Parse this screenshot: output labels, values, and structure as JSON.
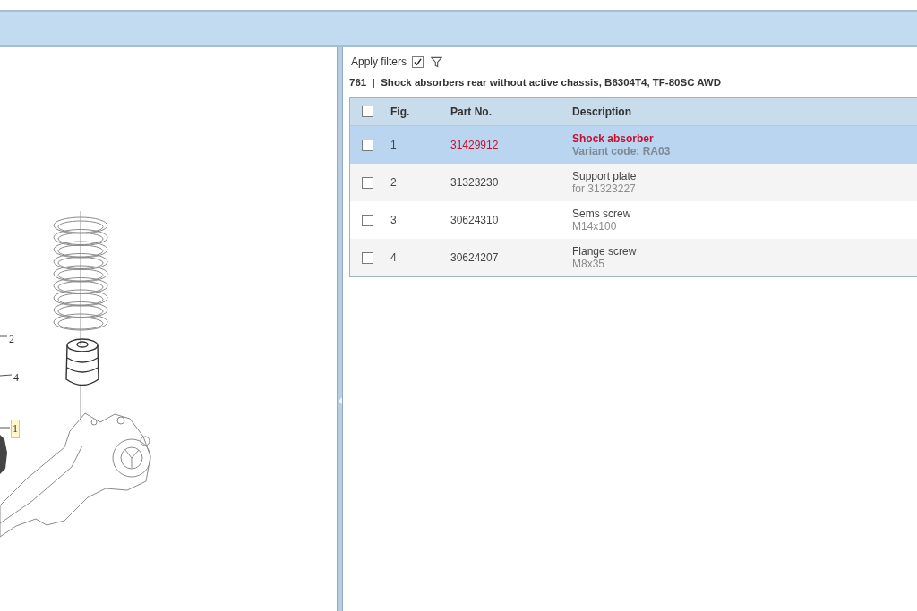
{
  "diagram": {
    "callouts": [
      {
        "label": "2",
        "selected": false
      },
      {
        "label": "4",
        "selected": false
      },
      {
        "label": "1",
        "selected": true
      }
    ]
  },
  "filters": {
    "label": "Apply filters",
    "checked": true
  },
  "group_title": "761  |  Shock absorbers rear without active chassis, B6304T4, TF-80SC AWD",
  "table": {
    "header_checked": false,
    "columns": [
      "Fig.",
      "Part No.",
      "Description"
    ],
    "rows": [
      {
        "fig": "1",
        "part_no": "31429912",
        "description": "Shock absorber",
        "note": "Variant code: RA03",
        "selected": true,
        "checked": false
      },
      {
        "fig": "2",
        "part_no": "31323230",
        "description": "Support plate",
        "note": "for 31323227",
        "selected": false,
        "checked": false
      },
      {
        "fig": "3",
        "part_no": "30624310",
        "description": "Sems screw",
        "note": "M14x100",
        "selected": false,
        "checked": false
      },
      {
        "fig": "4",
        "part_no": "30624207",
        "description": "Flange screw",
        "note": "M8x35",
        "selected": false,
        "checked": false
      }
    ]
  }
}
